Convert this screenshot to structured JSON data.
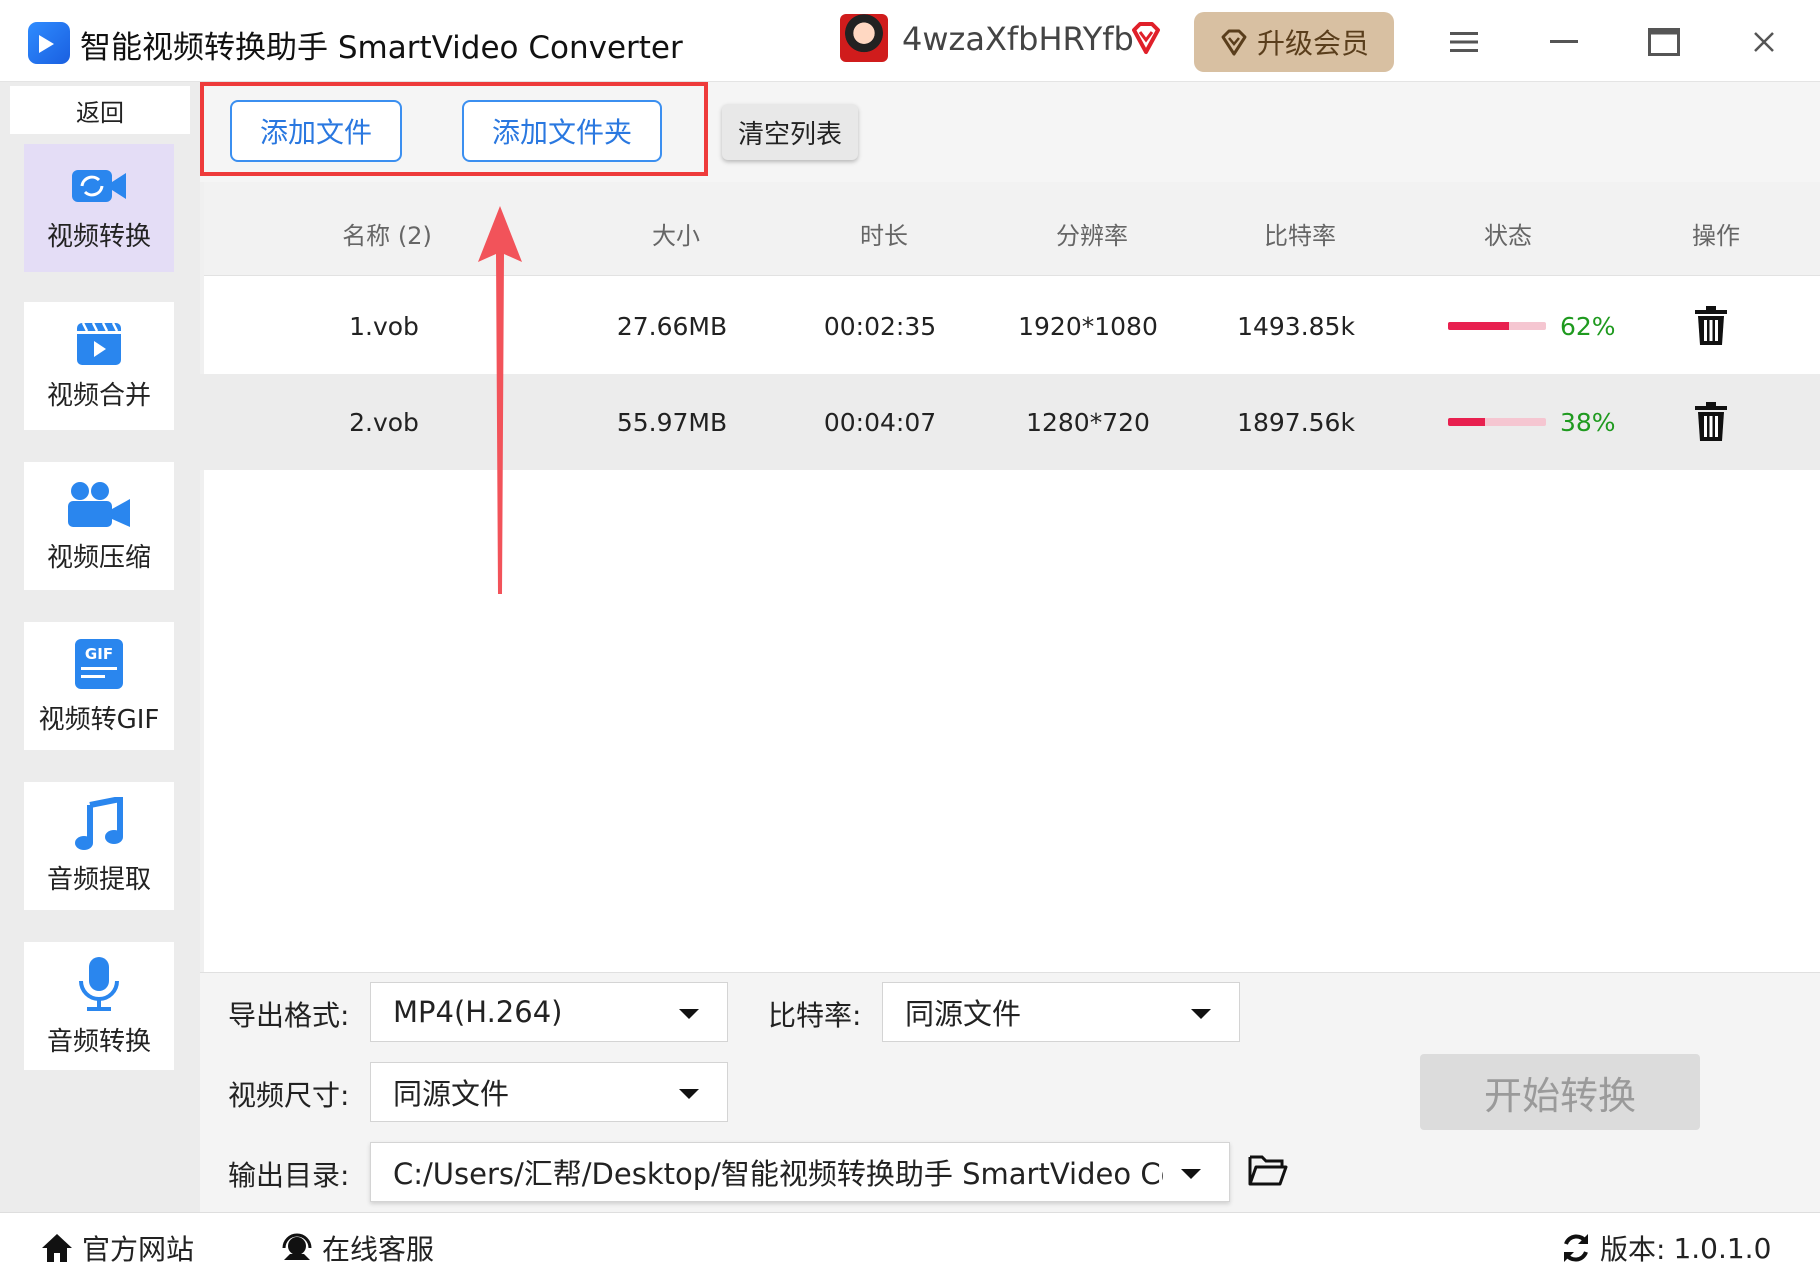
{
  "window": {
    "title": "智能视频转换助手 SmartVideo Converter",
    "username": "4wzaXfbHRYfb",
    "upgrade_label": "升级会员"
  },
  "sidebar": {
    "back_label": "返回",
    "items": [
      {
        "label": "视频转换",
        "icon": "video-convert-icon",
        "active": true
      },
      {
        "label": "视频合并",
        "icon": "video-merge-icon",
        "active": false
      },
      {
        "label": "视频压缩",
        "icon": "video-compress-icon",
        "active": false
      },
      {
        "label": "视频转GIF",
        "icon": "gif-icon",
        "active": false
      },
      {
        "label": "音频提取",
        "icon": "music-note-icon",
        "active": false
      },
      {
        "label": "音频转换",
        "icon": "microphone-icon",
        "active": false
      }
    ]
  },
  "toolbar": {
    "add_file_label": "添加文件",
    "add_folder_label": "添加文件夹",
    "clear_list_label": "清空列表"
  },
  "table": {
    "columns": [
      "名称 (2)",
      "大小",
      "时长",
      "分辨率",
      "比特率",
      "状态",
      "操作"
    ],
    "rows": [
      {
        "name": "1.vob",
        "size": "27.66MB",
        "duration": "00:02:35",
        "resolution": "1920*1080",
        "bitrate": "1493.85k",
        "progress": 0.62,
        "progress_label": "62%"
      },
      {
        "name": "2.vob",
        "size": "55.97MB",
        "duration": "00:04:07",
        "resolution": "1280*720",
        "bitrate": "1897.56k",
        "progress": 0.38,
        "progress_label": "38%"
      }
    ]
  },
  "settings": {
    "format_label": "导出格式:",
    "format_value": "MP4(H.264)",
    "bitrate_label": "比特率:",
    "bitrate_value": "同源文件",
    "size_label": "视频尺寸:",
    "size_value": "同源文件",
    "output_label": "输出目录:",
    "output_value": "C:/Users/汇帮/Desktop/智能视频转换助手 SmartVideo Cor",
    "start_label": "开始转换"
  },
  "footer": {
    "website_label": "官方网站",
    "support_label": "在线客服",
    "version_label": "版本:",
    "version_value": "1.0.1.0"
  },
  "colors": {
    "accent_blue": "#2a78e0",
    "highlight_red": "#ee3b3b",
    "progress_pink": "#e8204f",
    "progress_green": "#1f9a1f",
    "upgrade_tan": "#d8c0a2"
  }
}
